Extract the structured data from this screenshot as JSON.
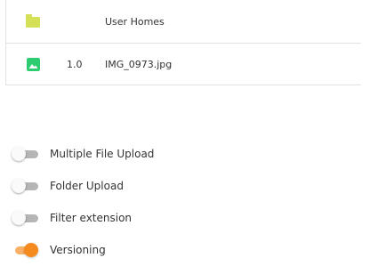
{
  "files": {
    "rows": [
      {
        "icon": "folder-icon",
        "icon_color": "#d4e157",
        "version": "",
        "name": "User Homes"
      },
      {
        "icon": "image-icon",
        "icon_color": "#2ecc71",
        "version": "1.0",
        "name": "IMG_0973.jpg"
      }
    ]
  },
  "options": [
    {
      "label": "Multiple File Upload",
      "enabled": false
    },
    {
      "label": "Folder Upload",
      "enabled": false
    },
    {
      "label": "Filter extension",
      "enabled": false
    },
    {
      "label": "Versioning",
      "enabled": true
    }
  ],
  "colors": {
    "toggle_on": "#f58b1f",
    "toggle_off_track": "#b5b5b5",
    "border": "#e2e2e2"
  }
}
